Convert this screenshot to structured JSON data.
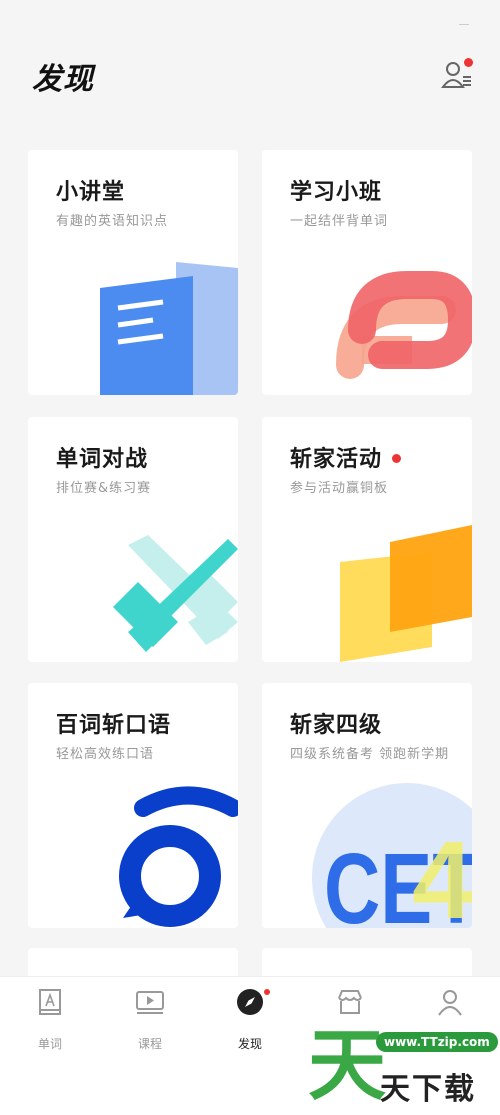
{
  "header": {
    "title": "发现"
  },
  "cards": [
    {
      "title": "小讲堂",
      "subtitle": "有趣的英语知识点"
    },
    {
      "title": "学习小班",
      "subtitle": "一起结伴背单词"
    },
    {
      "title": "单词对战",
      "subtitle": "排位赛&练习赛"
    },
    {
      "title": "斩家活动",
      "subtitle": "参与活动赢铜板"
    },
    {
      "title": "百词斩口语",
      "subtitle": "轻松高效练口语"
    },
    {
      "title": "斩家四级",
      "subtitle": "四级系统备考 领跑新学期"
    }
  ],
  "cet_art": {
    "letters": "CET",
    "number": "4"
  },
  "tabs": [
    {
      "label": "单词",
      "icon": "word-book-icon"
    },
    {
      "label": "课程",
      "icon": "video-course-icon"
    },
    {
      "label": "发现",
      "icon": "compass-icon"
    },
    {
      "label": "",
      "icon": "store-icon"
    },
    {
      "label": "",
      "icon": "person-icon"
    }
  ],
  "watermark": {
    "url": "www.TTzip.com",
    "big": "天",
    "text": "天下载"
  },
  "colors": {
    "accent_red": "#e33333",
    "active_tab": "#222222"
  }
}
